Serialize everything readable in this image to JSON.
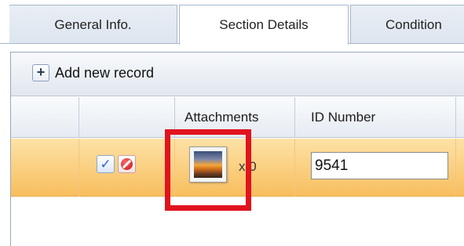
{
  "tabs": [
    {
      "label": "General Info.",
      "active": false
    },
    {
      "label": "Section Details",
      "active": true
    },
    {
      "label": "Condition",
      "active": false
    }
  ],
  "toolbar": {
    "add_icon": "plus-icon",
    "add_label": "Add new record"
  },
  "grid": {
    "columns": [
      "",
      "",
      "Attachments",
      "ID Number"
    ],
    "row": {
      "selected": true,
      "attachment_thumbnail": "sunset-photo-thumbnail",
      "attachment_count": "x 0",
      "id_number": "9541"
    }
  },
  "colors": {
    "selected_row": "#f8be5e",
    "highlight": "#e0141e",
    "check": "#2a66c8",
    "cancel": "#c30d0d"
  }
}
